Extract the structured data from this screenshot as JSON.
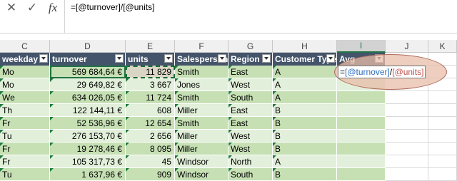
{
  "formula_bar": {
    "cancel_icon": "close-icon",
    "enter_icon": "check-icon",
    "fx_label": "fx",
    "formula": "=[@turnover]/[@units]"
  },
  "columns": [
    "C",
    "D",
    "E",
    "F",
    "G",
    "H",
    "I",
    "J",
    "K"
  ],
  "table": {
    "headers": [
      "weekday",
      "turnover",
      "units",
      "Salesperson",
      "Region",
      "Customer Type",
      "Avg"
    ],
    "rows": [
      [
        "Mo",
        "569 684,64 €",
        "11 829",
        "Smith",
        "East",
        "A",
        ""
      ],
      [
        "Mo",
        "29 649,82 €",
        "3 667",
        "Jones",
        "West",
        "A",
        ""
      ],
      [
        "We",
        "634 026,05 €",
        "11 724",
        "Smith",
        "South",
        "A",
        ""
      ],
      [
        "Th",
        "122 144,11 €",
        "608",
        "Miller",
        "East",
        "B",
        ""
      ],
      [
        "Fr",
        "52 536,96 €",
        "12 654",
        "Smith",
        "East",
        "B",
        ""
      ],
      [
        "Tu",
        "276 153,70 €",
        "2 656",
        "Miller",
        "West",
        "B",
        ""
      ],
      [
        "Fr",
        "19 278,46 €",
        "8 095",
        "Miller",
        "West",
        "B",
        ""
      ],
      [
        "Fr",
        "105 317,73 €",
        "45",
        "Windsor",
        "North",
        "A",
        ""
      ],
      [
        "Tu",
        "1 637,96 €",
        "909",
        "Windsor",
        "South",
        "B",
        ""
      ]
    ]
  },
  "edit_cell": {
    "eq": "=",
    "ref1": "[@turnover]",
    "slash": "/",
    "ref2": "[@units]"
  },
  "colors": {
    "header_bg": "#44546a",
    "band_light": "#e2efda",
    "band_dark": "#c6e0b4",
    "accent": "#217346"
  }
}
